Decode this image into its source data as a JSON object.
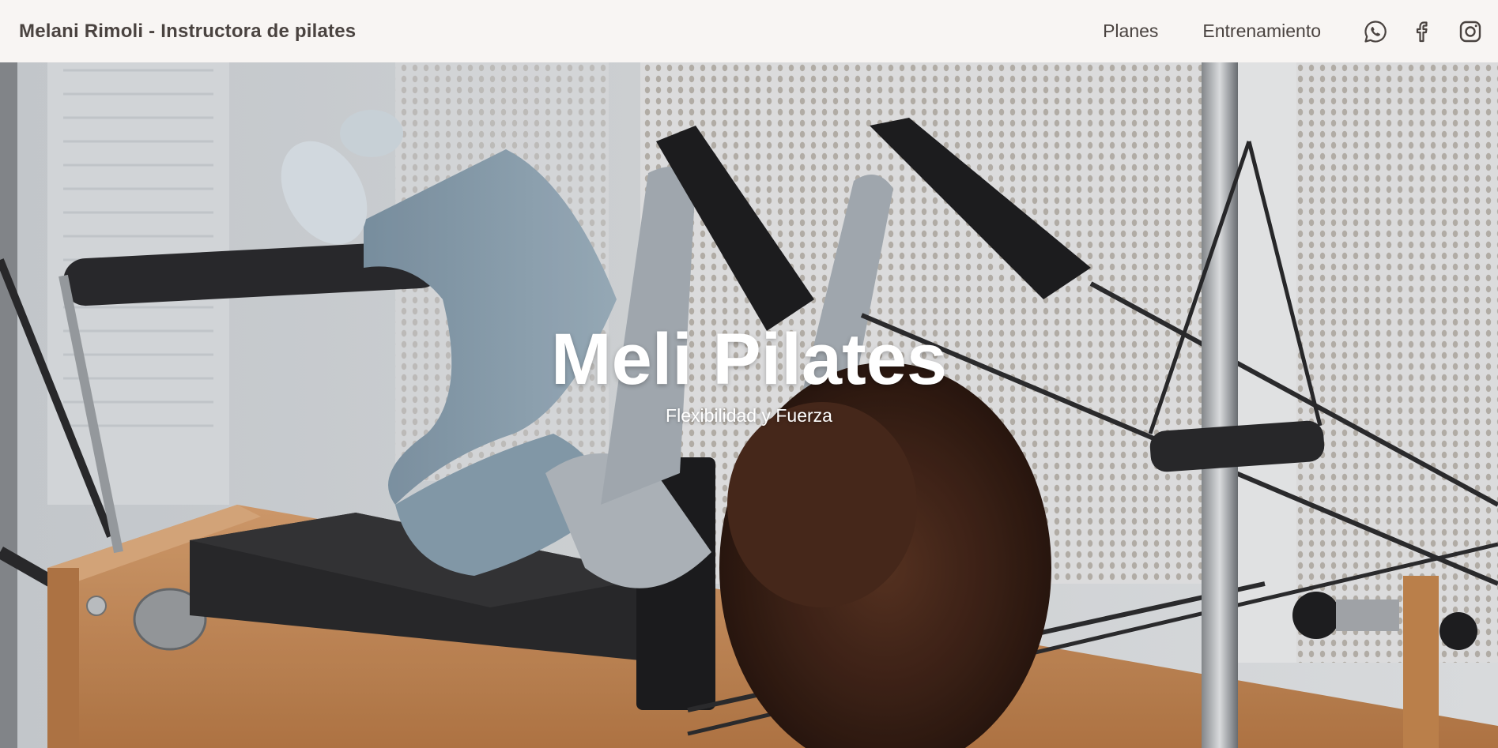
{
  "header": {
    "brand": "Melani Rimoli - Instructora de pilates",
    "nav": [
      {
        "label": "Planes"
      },
      {
        "label": "Entrenamiento"
      }
    ],
    "social": [
      {
        "icon": "whatsapp-icon"
      },
      {
        "icon": "facebook-icon"
      },
      {
        "icon": "instagram-icon"
      }
    ]
  },
  "hero": {
    "title": "Meli Pilates",
    "subtitle": "Flexibilidad y Fuerza",
    "photo": "woman-on-pilates-reformer"
  },
  "colors": {
    "navbar_bg": "#f8f5f3",
    "nav_text": "#4a4340",
    "hero_text": "#ffffff",
    "wood": "#c98a55"
  }
}
